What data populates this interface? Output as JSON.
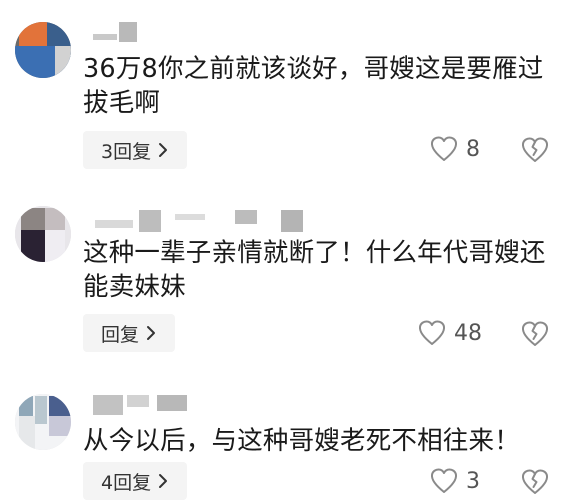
{
  "comments": [
    {
      "text": "36万8你之前就该谈好，哥嫂这是要雁过拔毛啊",
      "reply_label": "3回复",
      "likes": "8"
    },
    {
      "text": "这种一辈子亲情就断了！什么年代哥嫂还能卖妹妹",
      "reply_label": "回复",
      "likes": "48"
    },
    {
      "text": "从今以后，与这种哥嫂老死不相往来！",
      "reply_label": "4回复",
      "likes": "3"
    }
  ],
  "icons": {
    "like": "heart-outline-icon",
    "dislike": "broken-heart-icon",
    "chevron": "chevron-right-icon"
  },
  "colors": {
    "icon_gray": "#8a8a8a",
    "button_bg": "#f4f4f4",
    "text": "#1a1a1a"
  }
}
